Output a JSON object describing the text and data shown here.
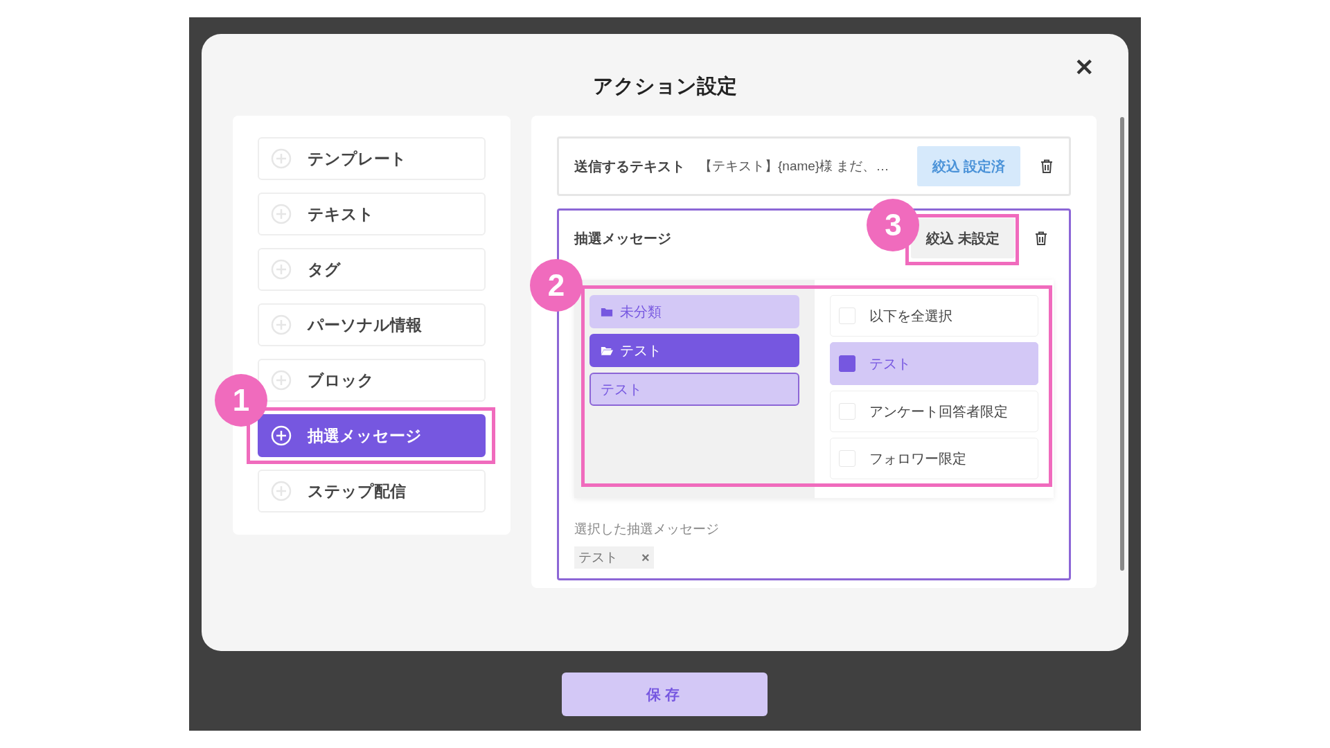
{
  "dialog": {
    "title": "アクション設定",
    "close": "✕"
  },
  "actions": [
    {
      "label": "テンプレート",
      "selected": false
    },
    {
      "label": "テキスト",
      "selected": false
    },
    {
      "label": "タグ",
      "selected": false
    },
    {
      "label": "パーソナル情報",
      "selected": false
    },
    {
      "label": "ブロック",
      "selected": false
    },
    {
      "label": "抽選メッセージ",
      "selected": true,
      "marker": "1"
    },
    {
      "label": "ステップ配信",
      "selected": false
    }
  ],
  "cards": [
    {
      "title": "送信するテキスト",
      "preview": "【テキスト】{name}様 まだ、…",
      "filter": "絞込 設定済",
      "filter_set": true,
      "active": false
    },
    {
      "title": "抽選メッセージ",
      "filter": "絞込 未設定",
      "filter_set": false,
      "active": true,
      "filter_marker": "3",
      "picker": {
        "marker": "2",
        "folders": [
          {
            "label": "未分類",
            "kind": "folder",
            "selected": false,
            "expanded": false
          },
          {
            "label": "テスト",
            "kind": "folder",
            "selected": true,
            "expanded": true
          },
          {
            "label": "テスト",
            "kind": "message",
            "selected": false
          }
        ],
        "options": [
          {
            "label": "以下を全選択",
            "checked": false
          },
          {
            "label": "テスト",
            "checked": true
          },
          {
            "label": "アンケート回答者限定",
            "checked": false
          },
          {
            "label": "フォロワー限定",
            "checked": false
          }
        ]
      },
      "selected_label": "選択した抽選メッセージ",
      "chips": [
        {
          "label": "テスト",
          "remove": "×"
        }
      ]
    }
  ],
  "save": "保存"
}
